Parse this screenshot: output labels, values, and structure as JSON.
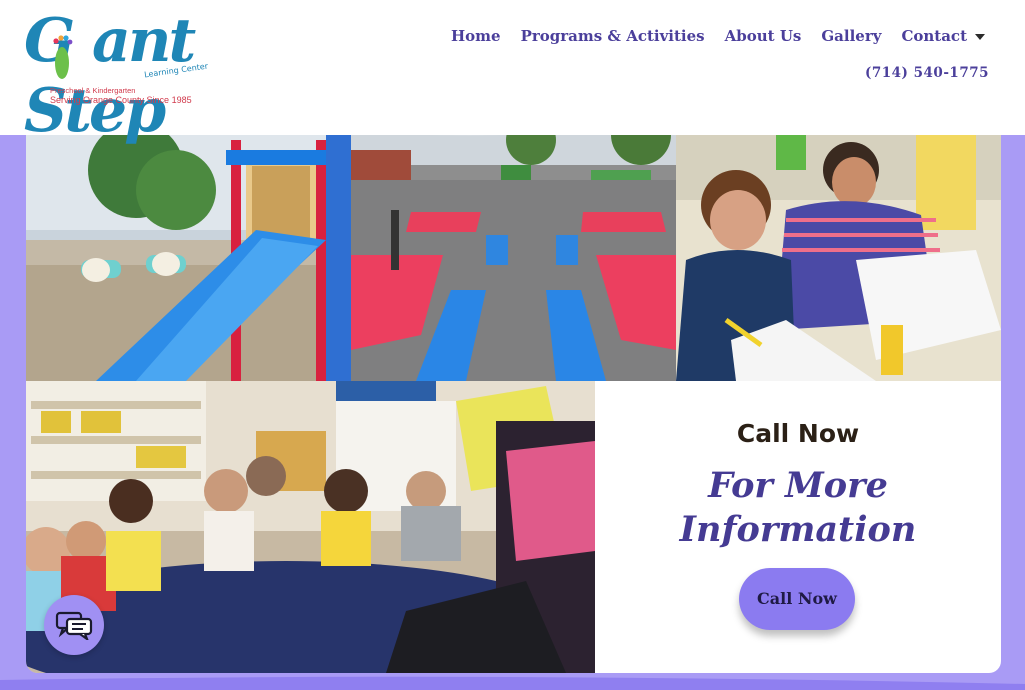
{
  "logo": {
    "brand": "GiantStep",
    "tagline": "Learning Center",
    "sub1": "Preschool & Kindergarten",
    "sub2": "Serving Orange County Since 1985"
  },
  "nav": {
    "items": [
      {
        "label": "Home"
      },
      {
        "label": "Programs & Activities"
      },
      {
        "label": "About Us"
      },
      {
        "label": "Gallery"
      },
      {
        "label": "Contact"
      }
    ],
    "phone": "(714) 540-1775"
  },
  "cta": {
    "small": "Call Now",
    "line1": "For More",
    "line2": "Information",
    "button": "Call Now"
  },
  "colors": {
    "brand_blue": "#1f86b6",
    "nav_purple": "#4b3f9b",
    "accent_red": "#d13a4c",
    "lavender_bg": "#a99bf5",
    "button_purple": "#8b7bf0"
  },
  "icons": {
    "contact_dropdown": "chevron-down-icon",
    "chat": "chat-bubbles-icon"
  }
}
